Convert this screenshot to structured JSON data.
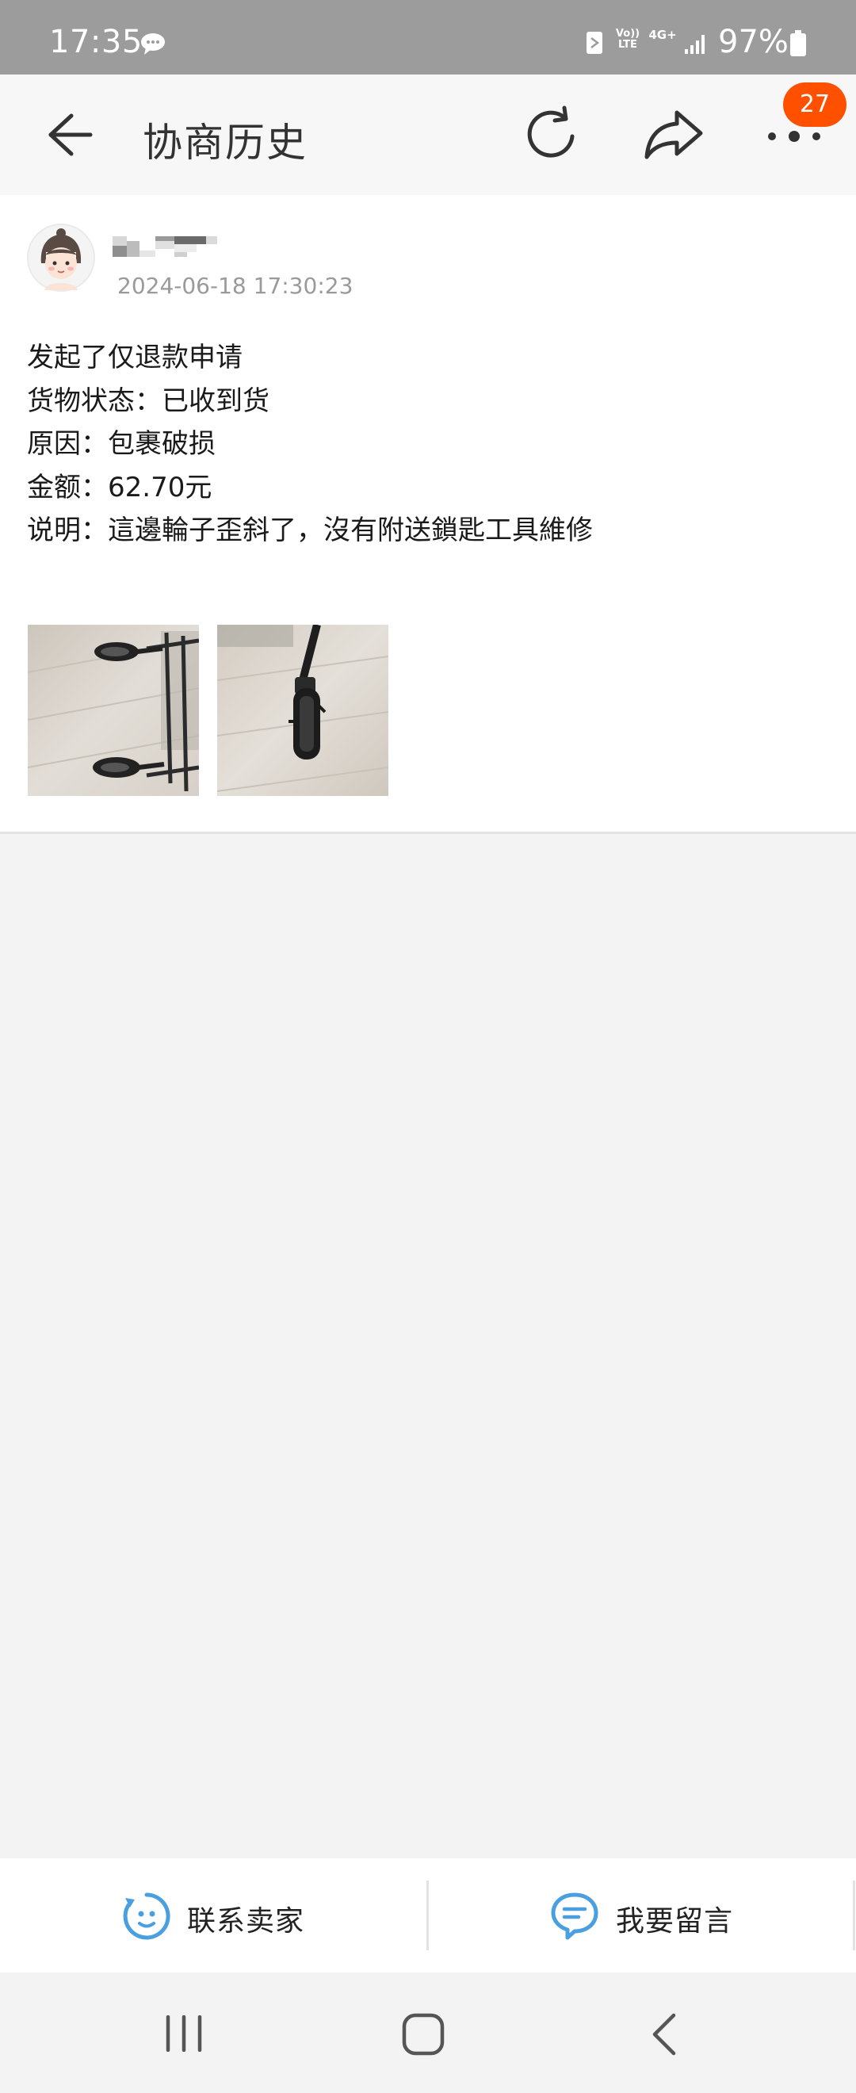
{
  "status_bar": {
    "time": "17:35",
    "volte_label": "Vo)) LTE",
    "network_label": "4G+",
    "battery_percent": "97%",
    "icons": [
      "chat-bubble-icon",
      "nfc-icon",
      "volte-icon",
      "network-4g-icon",
      "signal-icon",
      "battery-icon"
    ]
  },
  "header": {
    "title": "协商历史",
    "badge_count": "27",
    "badge_color": "#ff5000",
    "icons": [
      "back-arrow-icon",
      "refresh-icon",
      "share-icon",
      "more-dots-icon"
    ]
  },
  "record": {
    "timestamp": "2024-06-18 17:30:23",
    "lines": [
      "发起了仅退款申请",
      "货物状态：已收到货",
      "原因：包裹破损",
      "金额：62.70元",
      "说明：這邊輪子歪斜了，沒有附送鎖匙工具維修"
    ]
  },
  "actions": {
    "contact_seller": "联系卖家",
    "leave_message": "我要留言",
    "icon_color": "#4a9fe0"
  },
  "nav": {
    "icons": [
      "recents-icon",
      "home-icon",
      "back-icon"
    ]
  }
}
